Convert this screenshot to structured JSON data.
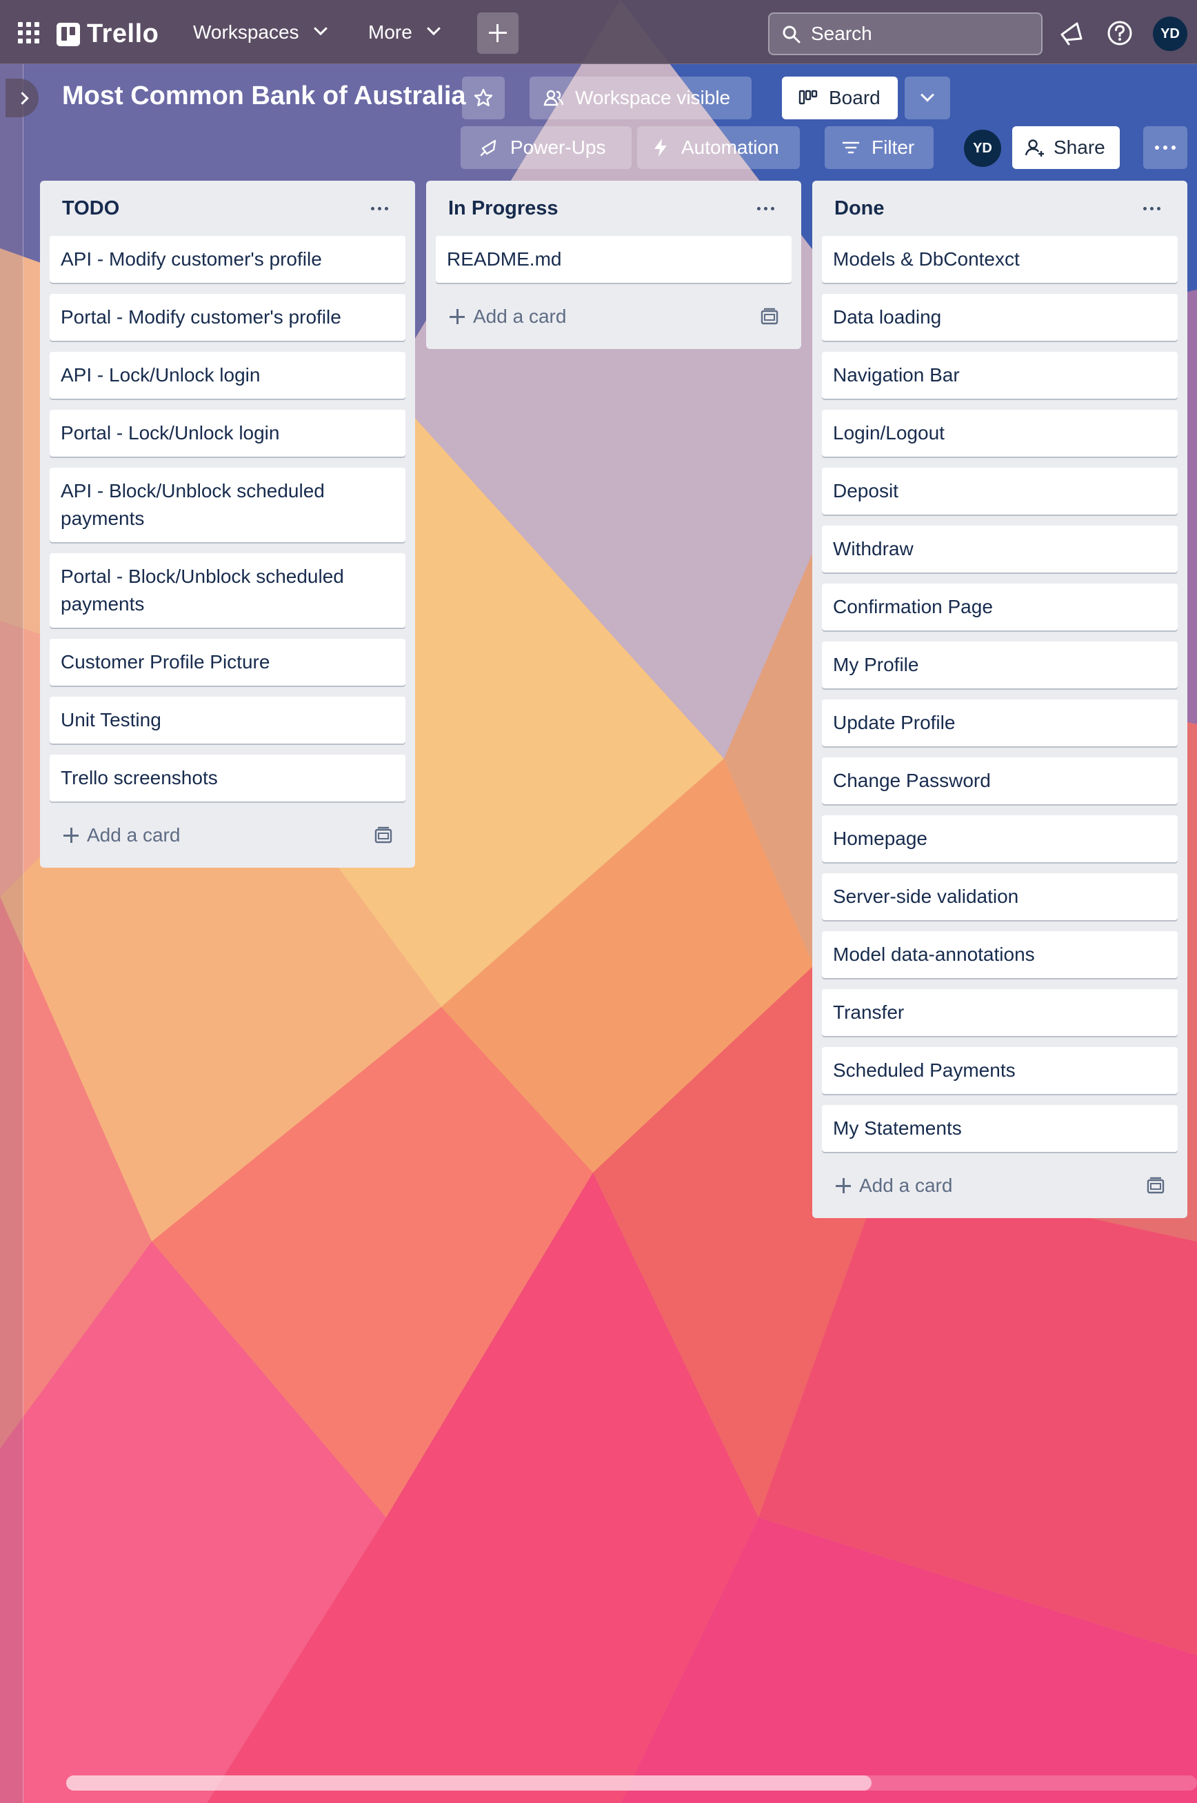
{
  "nav": {
    "logo": "Trello",
    "workspaces": "Workspaces",
    "more": "More",
    "search_placeholder": "Search",
    "avatar": "YD",
    "colors": {
      "bar": "#5a4c60",
      "avatar": "#0b2a4a"
    }
  },
  "board": {
    "title": "Most Common Bank of Australia",
    "visibility": "Workspace visible",
    "view": "Board",
    "power_ups": "Power-Ups",
    "automation": "Automation",
    "filter": "Filter",
    "member_avatar": "YD",
    "share": "Share"
  },
  "lists": [
    {
      "title": "TODO",
      "cards": [
        "API - Modify customer's profile",
        "Portal - Modify customer's profile",
        "API - Lock/Unlock login",
        "Portal - Lock/Unlock login",
        "API - Block/Unblock scheduled payments",
        "Portal - Block/Unblock scheduled payments",
        "Customer Profile Picture",
        "Unit Testing",
        "Trello screenshots"
      ],
      "add_label": "Add a card"
    },
    {
      "title": "In Progress",
      "cards": [
        "README.md"
      ],
      "add_label": "Add a card"
    },
    {
      "title": "Done",
      "cards": [
        "Models & DbContexct",
        "Data loading",
        "Navigation Bar",
        "Login/Logout",
        "Deposit",
        "Withdraw",
        "Confirmation Page",
        "My Profile",
        "Update Profile",
        "Change Password",
        "Homepage",
        "Server-side validation",
        "Model data-annotations",
        "Transfer",
        "Scheduled Payments",
        "My Statements"
      ],
      "add_label": "Add a card"
    }
  ],
  "icons": {
    "apps": "apps-grid-icon",
    "create": "plus-icon",
    "search": "search-icon",
    "notifications": "megaphone-icon",
    "help": "help-icon",
    "star": "star-icon",
    "visibility": "people-icon",
    "board": "board-icon",
    "power_ups": "rocket-icon",
    "automation": "lightning-icon",
    "filter": "filter-icon",
    "share": "add-person-icon",
    "card_template": "template-icon"
  }
}
